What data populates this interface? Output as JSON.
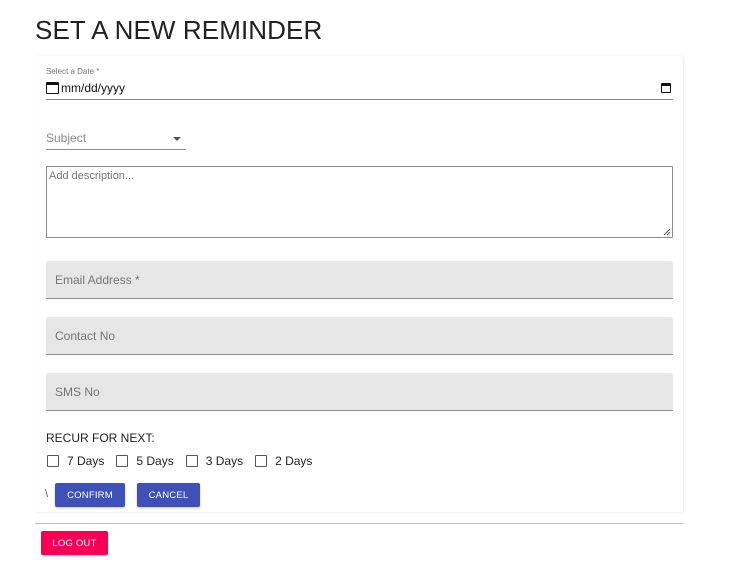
{
  "page": {
    "title": "SET A NEW REMINDER"
  },
  "form": {
    "date": {
      "label": "Select a Date *",
      "placeholder": "mm/dd/yyyy"
    },
    "subject": {
      "label": "Subject"
    },
    "description": {
      "placeholder": "Add description..."
    },
    "email": {
      "label": "Email Address *"
    },
    "contact": {
      "label": "Contact No"
    },
    "sms": {
      "label": "SMS No"
    },
    "recur": {
      "label": "RECUR FOR NEXT:",
      "options": [
        "7 Days",
        "5 Days",
        "3 Days",
        "2 Days"
      ]
    },
    "stray_text": "\\",
    "buttons": {
      "confirm": "CONFIRM",
      "cancel": "CANCEL"
    }
  },
  "footer": {
    "logout": "LOG OUT"
  },
  "colors": {
    "primary": "#3f51b5",
    "secondary": "#f50057",
    "field_bg": "#e6e6e6"
  },
  "icons": {
    "date": "calendar-icon",
    "date_picker": "calendar-picker-icon",
    "subject": "dropdown-caret-icon"
  }
}
